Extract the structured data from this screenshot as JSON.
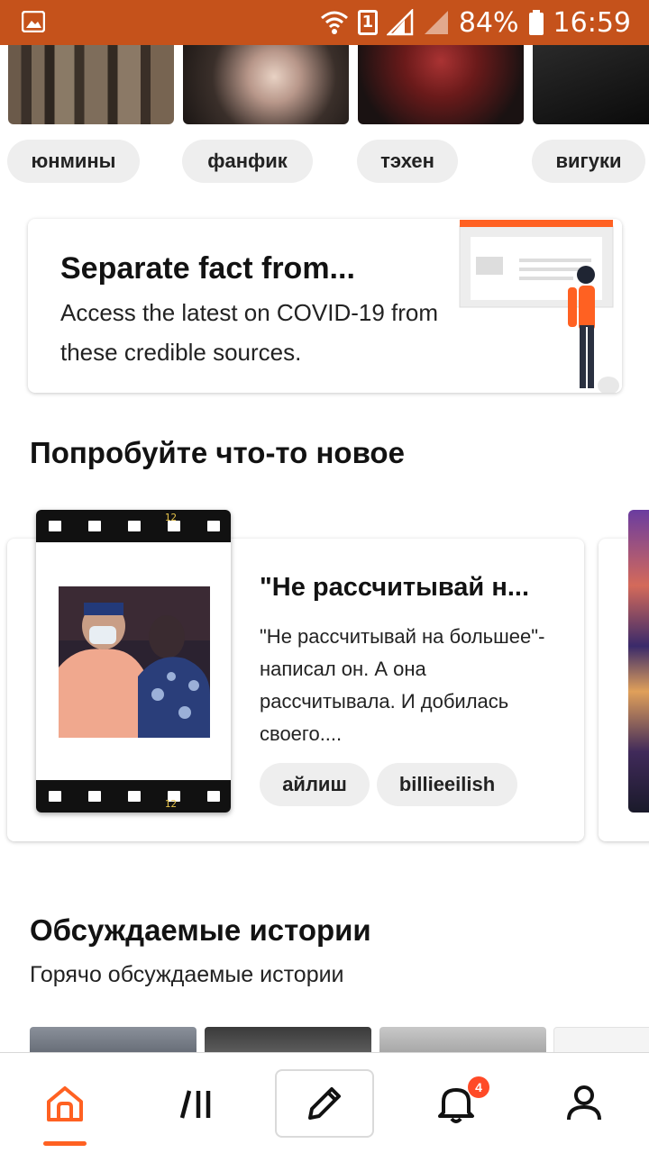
{
  "status_bar": {
    "battery": "84%",
    "time": "16:59",
    "sim": "1",
    "bg_color": "#c5521b"
  },
  "top_tags": [
    "юнмины",
    "фанфик",
    "тэхен",
    "вигуки"
  ],
  "covid_card": {
    "title": "Separate fact from...",
    "text": "Access the latest on COVID-19 from these credible sources.",
    "accent_color": "#ff6122"
  },
  "try_new": {
    "heading": "Попробуйте что-то новое",
    "story": {
      "title": "\"Не рассчитывай н...",
      "description": "\"Не рассчитывай на большее\"-написал он. А она рассчитывала. И добилась своего....",
      "tags": [
        "айлиш",
        "billieeilish"
      ],
      "film_number": "12"
    }
  },
  "discussed": {
    "heading": "Обсуждаемые истории",
    "subheading": "Горячо обсуждаемые истории"
  },
  "nav": {
    "items": [
      "home-icon",
      "library-icon",
      "write-icon",
      "notifications-icon",
      "profile-icon"
    ],
    "active": "home",
    "notification_count": "4",
    "accent_color": "#ff6122"
  }
}
